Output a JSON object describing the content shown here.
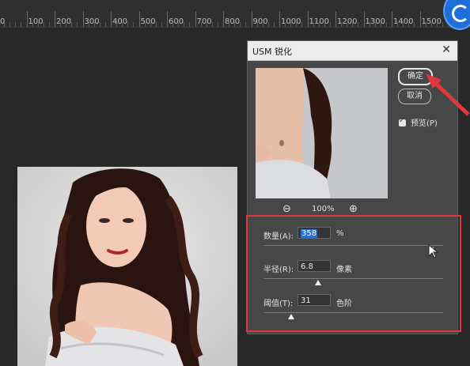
{
  "ruler": {
    "ticks": [
      "0",
      "100",
      "200",
      "300",
      "400",
      "500",
      "600",
      "700",
      "800",
      "900",
      "1000",
      "1100",
      "1200",
      "1300",
      "1400",
      "1500"
    ]
  },
  "dialog": {
    "title": "USM 锐化",
    "close_icon": "close-icon",
    "ok_label": "确定",
    "cancel_label": "取消",
    "preview_checkbox": {
      "label": "预览(P)",
      "checked": true
    },
    "zoom": {
      "value": "100%",
      "zoom_out_icon": "zoom-out-icon",
      "zoom_in_icon": "zoom-in-icon"
    },
    "params": [
      {
        "label": "数量(A):",
        "value": "358",
        "unit": "%",
        "selected": true
      },
      {
        "label": "半径(R):",
        "value": "6.8",
        "unit": "像素"
      },
      {
        "label": "阈值(T):",
        "value": "31",
        "unit": "色阶"
      }
    ]
  },
  "colors": {
    "highlight": "#e0383c",
    "selection": "#2d6fc9",
    "dialog_bg": "#474747"
  }
}
